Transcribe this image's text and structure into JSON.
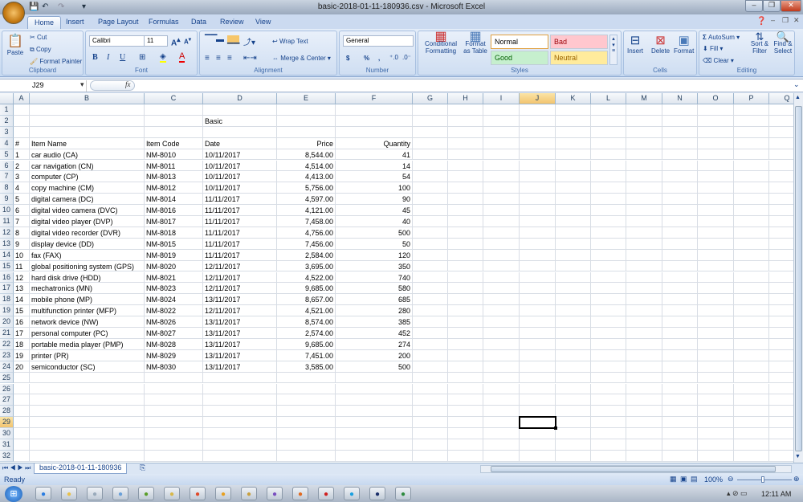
{
  "window": {
    "title": "basic-2018-01-11-180936.csv - Microsoft Excel",
    "min": "–",
    "max": "❐",
    "close": "✕"
  },
  "qat": {
    "save": "💾",
    "undo": "↶",
    "redo": "↷",
    "more": "▾"
  },
  "tabs": [
    "Home",
    "Insert",
    "Page Layout",
    "Formulas",
    "Data",
    "Review",
    "View"
  ],
  "ribbon": {
    "clipboard": {
      "label": "Clipboard",
      "paste": "Paste",
      "cut": "Cut",
      "copy": "Copy",
      "format_painter": "Format Painter"
    },
    "font": {
      "label": "Font",
      "name": "Calibri",
      "size": "11",
      "bold": "B",
      "italic": "I",
      "underline": "U"
    },
    "alignment": {
      "label": "Alignment",
      "wrap": "Wrap Text",
      "merge": "Merge & Center"
    },
    "number": {
      "label": "Number",
      "format": "General",
      "currency": "$",
      "percent": "%",
      "comma": ","
    },
    "styles": {
      "label": "Styles",
      "conditional": "Conditional Formatting",
      "format_table": "Format as Table",
      "normal": "Normal",
      "bad": "Bad",
      "good": "Good",
      "neutral": "Neutral"
    },
    "cells": {
      "label": "Cells",
      "insert": "Insert",
      "delete": "Delete",
      "format": "Format"
    },
    "editing": {
      "label": "Editing",
      "autosum": "AutoSum",
      "fill": "Fill",
      "clear": "Clear",
      "sort": "Sort & Filter",
      "find": "Find & Select"
    }
  },
  "formula_bar": {
    "name_box": "J29",
    "fx": "fx",
    "value": ""
  },
  "columns": [
    "A",
    "B",
    "C",
    "D",
    "E",
    "F",
    "G",
    "H",
    "I",
    "J",
    "K",
    "L",
    "M",
    "N",
    "O",
    "P",
    "Q"
  ],
  "selected_cell": {
    "col": "J",
    "row": 29
  },
  "sheet": {
    "title": "Basic",
    "headers": [
      "#",
      "Item Name",
      "Item Code",
      "Date",
      "Price",
      "Quantity"
    ],
    "rows": [
      [
        "1",
        "car audio (CA)",
        "NM-8010",
        "10/11/2017",
        "8,544.00",
        "41"
      ],
      [
        "2",
        "car navigation (CN)",
        "NM-8011",
        "10/11/2017",
        "4,514.00",
        "14"
      ],
      [
        "3",
        "computer (CP)",
        "NM-8013",
        "10/11/2017",
        "4,413.00",
        "54"
      ],
      [
        "4",
        "copy machine (CM)",
        "NM-8012",
        "10/11/2017",
        "5,756.00",
        "100"
      ],
      [
        "5",
        "digital camera (DC)",
        "NM-8014",
        "11/11/2017",
        "4,597.00",
        "90"
      ],
      [
        "6",
        "digital video camera (DVC)",
        "NM-8016",
        "11/11/2017",
        "4,121.00",
        "45"
      ],
      [
        "7",
        "digital video player (DVP)",
        "NM-8017",
        "11/11/2017",
        "7,458.00",
        "40"
      ],
      [
        "8",
        "digital video recorder (DVR)",
        "NM-8018",
        "11/11/2017",
        "4,756.00",
        "500"
      ],
      [
        "9",
        "display device (DD)",
        "NM-8015",
        "11/11/2017",
        "7,456.00",
        "50"
      ],
      [
        "10",
        "fax (FAX)",
        "NM-8019",
        "11/11/2017",
        "2,584.00",
        "120"
      ],
      [
        "11",
        "global positioning system (GPS)",
        "NM-8020",
        "12/11/2017",
        "3,695.00",
        "350"
      ],
      [
        "12",
        "hard disk drive (HDD)",
        "NM-8021",
        "12/11/2017",
        "4,522.00",
        "740"
      ],
      [
        "13",
        "mechatronics (MN)",
        "NM-8023",
        "12/11/2017",
        "9,685.00",
        "580"
      ],
      [
        "14",
        "mobile phone (MP)",
        "NM-8024",
        "13/11/2017",
        "8,657.00",
        "685"
      ],
      [
        "15",
        "multifunction printer (MFP)",
        "NM-8022",
        "12/11/2017",
        "4,521.00",
        "280"
      ],
      [
        "16",
        "network device (NW)",
        "NM-8026",
        "13/11/2017",
        "8,574.00",
        "385"
      ],
      [
        "17",
        "personal computer (PC)",
        "NM-8027",
        "13/11/2017",
        "2,574.00",
        "452"
      ],
      [
        "18",
        "portable media player (PMP)",
        "NM-8028",
        "13/11/2017",
        "9,685.00",
        "274"
      ],
      [
        "19",
        "printer (PR)",
        "NM-8029",
        "13/11/2017",
        "7,451.00",
        "200"
      ],
      [
        "20",
        "semiconductor (SC)",
        "NM-8030",
        "13/11/2017",
        "3,585.00",
        "500"
      ]
    ]
  },
  "sheet_tab": "basic-2018-01-11-180936",
  "status": {
    "text": "Ready",
    "zoom": "100%"
  },
  "taskbar": {
    "clock": "12:11 AM",
    "apps": [
      "ie-icon",
      "explorer-icon",
      "tablet-icon",
      "phone-icon",
      "arrow-icon",
      "notepad-icon",
      "chrome-icon",
      "media-icon",
      "folder-icon",
      "vs-icon",
      "firefox-icon",
      "opera-icon",
      "skype-icon",
      "photoshop-icon",
      "excel-icon"
    ]
  }
}
